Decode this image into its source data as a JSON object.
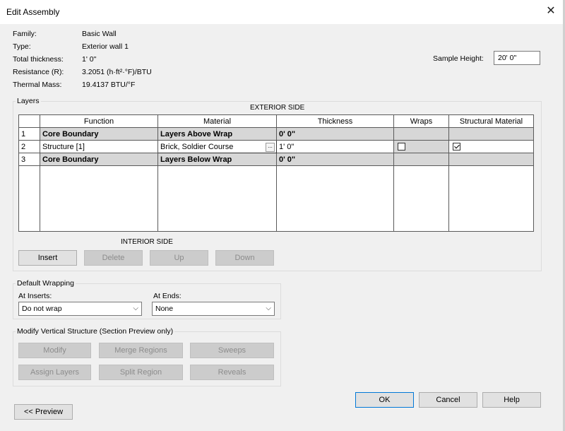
{
  "window": {
    "title": "Edit Assembly",
    "close_glyph": "✕"
  },
  "properties": [
    {
      "label": "Family:",
      "value": "Basic Wall"
    },
    {
      "label": "Type:",
      "value": "Exterior wall 1"
    },
    {
      "label": "Total thickness:",
      "value": "1'  0\""
    },
    {
      "label": "Resistance (R):",
      "value": "3.2051 (h·ft²·°F)/BTU"
    },
    {
      "label": "Thermal Mass:",
      "value": "19.4137 BTU/°F"
    }
  ],
  "sample_height": {
    "label": "Sample Height:",
    "value": "20'  0\""
  },
  "layers": {
    "group_label": "Layers",
    "exterior_label": "EXTERIOR SIDE",
    "interior_label": "INTERIOR SIDE",
    "columns": [
      "Function",
      "Material",
      "Thickness",
      "Wraps",
      "Structural Material"
    ],
    "rows": [
      {
        "num": "1",
        "function": "Core Boundary",
        "material": "Layers Above Wrap",
        "thickness": "0'  0\""
      },
      {
        "num": "2",
        "function": "Structure [1]",
        "material": "Brick, Soldier Course",
        "thickness": "1'  0\""
      },
      {
        "num": "3",
        "function": "Core Boundary",
        "material": "Layers Below Wrap",
        "thickness": "0'  0\""
      }
    ],
    "ellipsis": "...",
    "buttons": {
      "insert": "Insert",
      "delete": "Delete",
      "up": "Up",
      "down": "Down"
    }
  },
  "default_wrapping": {
    "group_label": "Default Wrapping",
    "at_inserts_label": "At Inserts:",
    "at_inserts_value": "Do not wrap",
    "at_ends_label": "At  Ends:",
    "at_ends_value": "None"
  },
  "modify_vertical": {
    "group_label": "Modify Vertical Structure (Section Preview only)",
    "buttons": {
      "modify": "Modify",
      "merge_regions": "Merge Regions",
      "sweeps": "Sweeps",
      "assign_layers": "Assign Layers",
      "split_region": "Split Region",
      "reveals": "Reveals"
    }
  },
  "footer": {
    "preview": "<< Preview",
    "ok": "OK",
    "cancel": "Cancel",
    "help": "Help"
  },
  "icons": {
    "close": "close-icon",
    "dropdown": "chevron-down-icon",
    "checkbox": "checkbox-icon"
  }
}
